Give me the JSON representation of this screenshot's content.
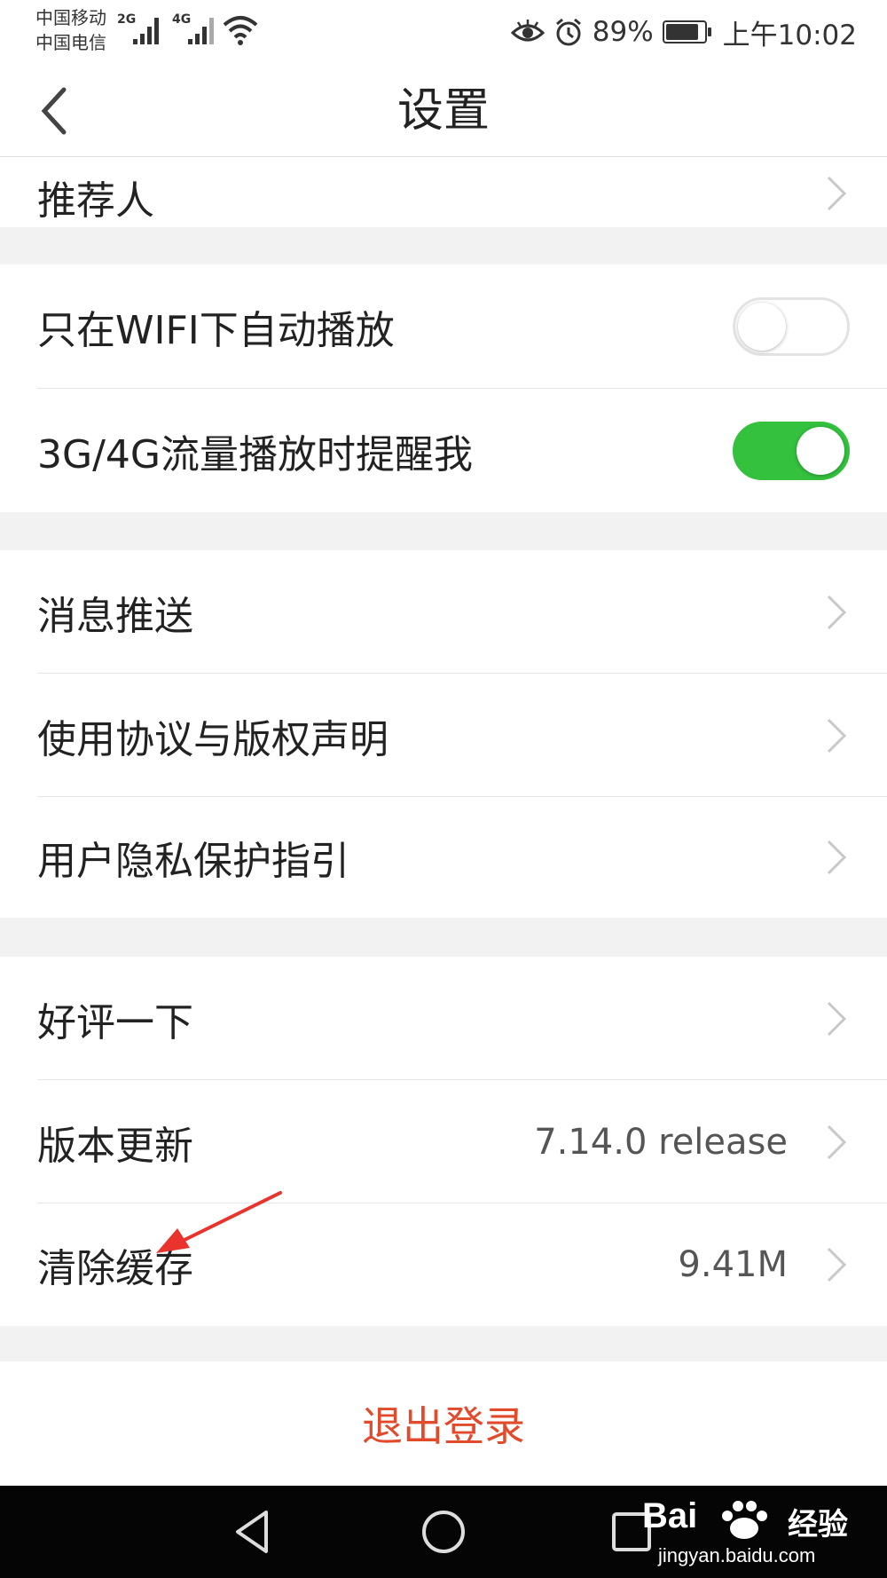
{
  "status_bar": {
    "carrier_1": "中国移动",
    "carrier_2": "中国电信",
    "net_1": "2G",
    "net_2": "4G",
    "battery_level": 0.89,
    "battery": "89%",
    "time": "上午10:02",
    "icons": [
      "signal-icon",
      "wifi-icon",
      "eye-icon",
      "alarm-icon",
      "battery-icon"
    ]
  },
  "header": {
    "title": "设置",
    "back_icon": "chevron-left-icon"
  },
  "rows": {
    "referrer": "推荐人",
    "wifi_autoplay": {
      "label": "只在WIFI下自动播放",
      "on": false
    },
    "cellular_remind": {
      "label": "3G/4G流量播放时提醒我",
      "on": true
    },
    "push": "消息推送",
    "agreement": "使用协议与版权声明",
    "privacy": "用户隐私保护指引",
    "rate": "好评一下",
    "version": {
      "label": "版本更新",
      "value": "7.14.0 release"
    },
    "cache": {
      "label": "清除缓存",
      "value": "9.41M"
    }
  },
  "logout": "退出登录",
  "colors": {
    "toggle_on": "#33c13e",
    "logout_text": "#e24a2c",
    "annotation_arrow": "#e8342c"
  },
  "nav_bar": [
    "back-triangle-icon",
    "home-circle-icon",
    "recents-square-icon"
  ],
  "watermark": {
    "brand": "Bai",
    "brand_cn": "经验",
    "url": "jingyan.baidu.com"
  }
}
